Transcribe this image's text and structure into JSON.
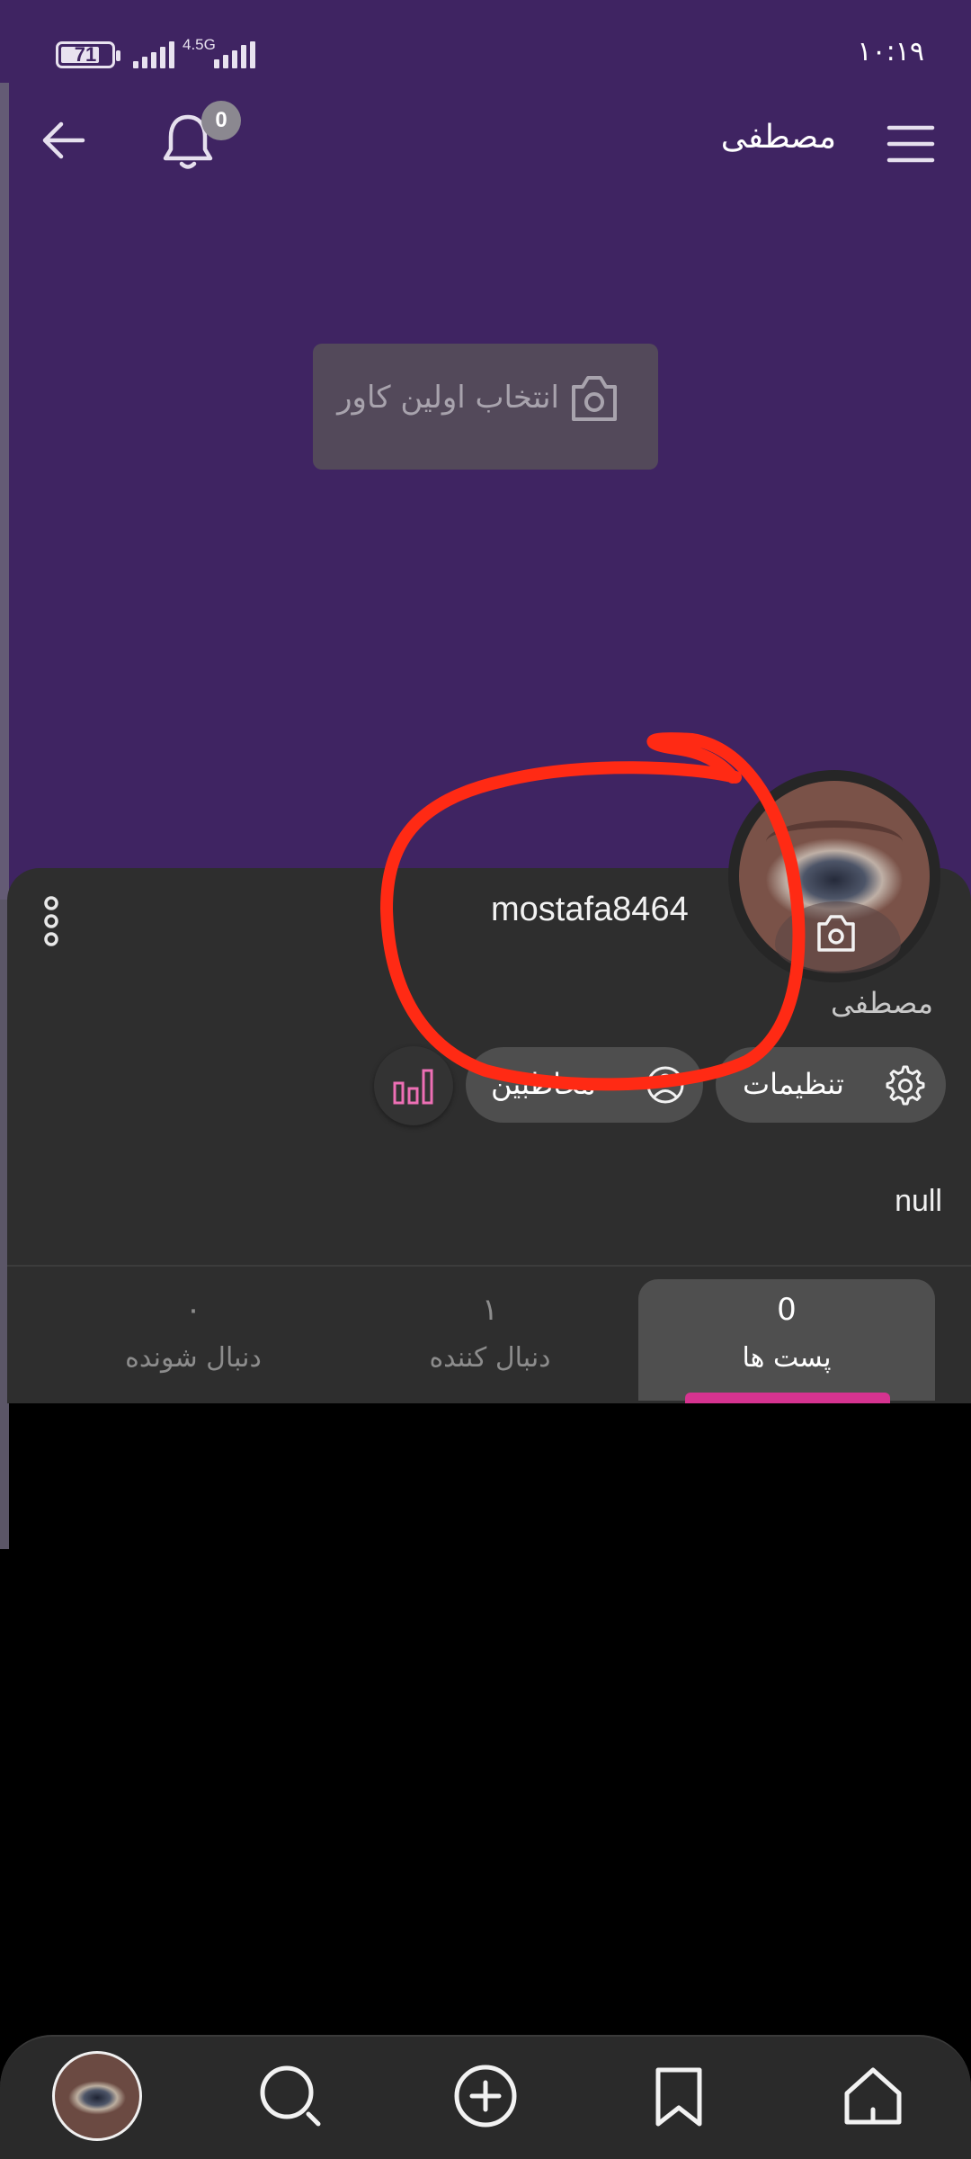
{
  "status_bar": {
    "battery": "71",
    "network": "4.5G",
    "time": "۱۰:۱۹"
  },
  "header": {
    "title": "مصطفی",
    "notification_count": "0"
  },
  "cover": {
    "select_label": "انتخاب اولین کاور"
  },
  "profile": {
    "username": "mostafa8464",
    "display_name": "مصطفی",
    "bio": "null",
    "buttons": {
      "settings": "تنظیمات",
      "followers": "مخاطبین"
    }
  },
  "tabs": [
    {
      "count": "0",
      "label": "پست ها",
      "active": true
    },
    {
      "count": "۱",
      "label": "دنبال کننده",
      "active": false
    },
    {
      "count": "۰",
      "label": "دنبال شونده",
      "active": false
    }
  ],
  "colors": {
    "cover_bg": "#3f2462",
    "sheet_bg": "#2e2e2e",
    "accent_pink": "#d63390",
    "annotation_red": "#ff2a14"
  },
  "bottom_nav": {
    "icons": [
      "profile-avatar",
      "search-icon",
      "add-circle-icon",
      "bookmark-icon",
      "home-icon"
    ]
  }
}
